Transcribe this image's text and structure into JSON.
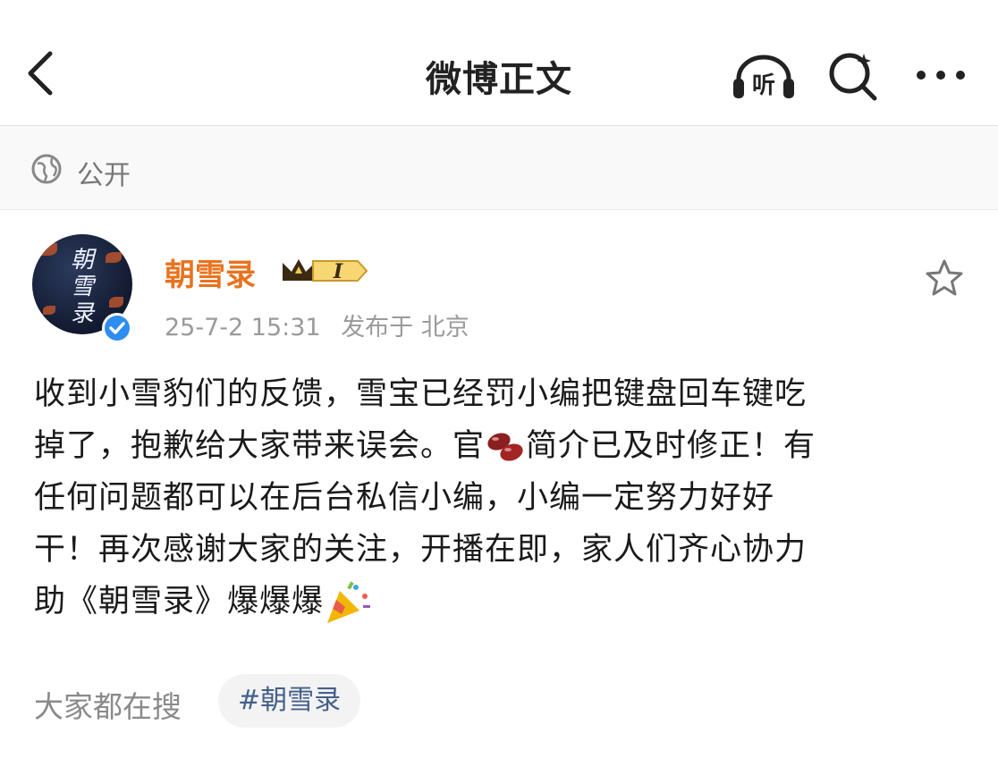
{
  "header": {
    "title": "微博正文",
    "listen_label": "听"
  },
  "visibility": {
    "label": "公开"
  },
  "author": {
    "name": "朝雪录",
    "avatar_text": "朝雪录",
    "vip_level": "I"
  },
  "post": {
    "date": "25-7-2 15:31",
    "location": "发布于 北京",
    "lines": [
      "收到小雪豹们的反馈，雪宝已经罚小编把键盘回车键吃",
      "掉了，抱歉给大家带来误会。官",
      "简介已及时修正！有",
      "任何问题都可以在后台私信小编，小编一定努力好好",
      "干！再次感谢大家的关注，开播在即，家人们齐心协力",
      "助《朝雪录》爆爆爆"
    ]
  },
  "footer": {
    "search_label": "大家都在搜",
    "hashtag": "#朝雪录"
  },
  "colors": {
    "username": "#e8731f",
    "verified": "#2f8df0",
    "hashtag": "#44608a"
  },
  "icons": [
    "back-icon",
    "listen-icon",
    "search-icon",
    "more-icon",
    "globe-icon",
    "verified-icon",
    "vip-crown-icon",
    "star-icon",
    "bean-emoji",
    "party-popper-emoji"
  ]
}
